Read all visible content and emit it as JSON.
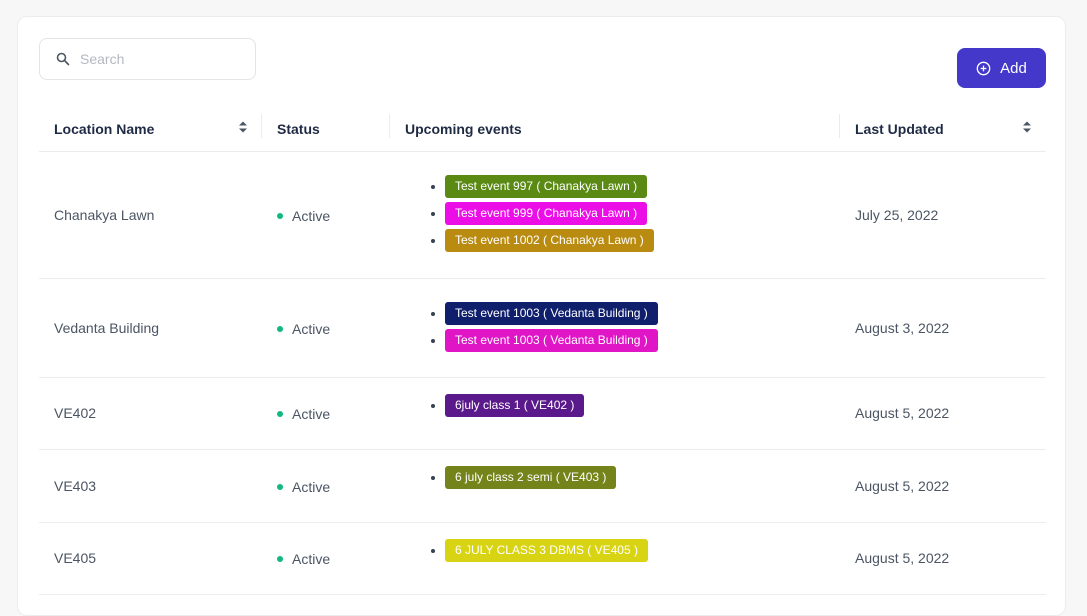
{
  "search": {
    "placeholder": "Search",
    "value": ""
  },
  "toolbar": {
    "add_label": "Add",
    "accent": "#4338ca"
  },
  "table": {
    "columns": [
      "Location Name",
      "Status",
      "Upcoming events",
      "Last Updated"
    ],
    "rows": [
      {
        "name": "Chanakya Lawn",
        "status": "Active",
        "events": [
          {
            "label": "Test event 997 ( Chanakya Lawn )",
            "color": "#5a8a14"
          },
          {
            "label": "Test event 999 ( Chanakya Lawn )",
            "color": "#ec0ee6"
          },
          {
            "label": "Test event 1002 ( Chanakya Lawn )",
            "color": "#b98b10"
          }
        ],
        "updated": "July 25, 2022"
      },
      {
        "name": "Vedanta Building",
        "status": "Active",
        "events": [
          {
            "label": "Test event 1003 ( Vedanta Building )",
            "color": "#0f1f6b"
          },
          {
            "label": "Test event 1003 ( Vedanta Building )",
            "color": "#e016c6"
          }
        ],
        "updated": "August 3, 2022"
      },
      {
        "name": "VE402",
        "status": "Active",
        "events": [
          {
            "label": "6july class 1 ( VE402 )",
            "color": "#5b1a8c"
          }
        ],
        "updated": "August 5, 2022"
      },
      {
        "name": "VE403",
        "status": "Active",
        "events": [
          {
            "label": "6 july class 2 semi ( VE403 )",
            "color": "#75841a"
          }
        ],
        "updated": "August 5, 2022"
      },
      {
        "name": "VE405",
        "status": "Active",
        "events": [
          {
            "label": "6 JULY CLASS 3 DBMS ( VE405 )",
            "color": "#d8d414"
          }
        ],
        "updated": "August 5, 2022"
      }
    ]
  }
}
